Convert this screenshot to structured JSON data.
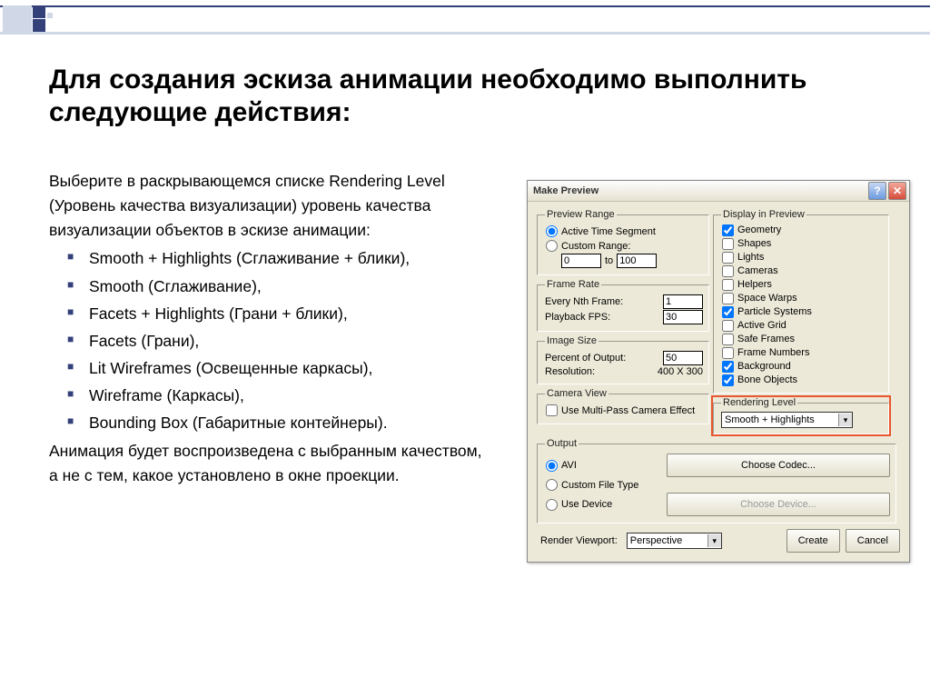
{
  "slide": {
    "title": "Для создания эскиза анимации необходимо выполнить следующие действия:",
    "intro": "Выберите в раскрывающемся списке Rendering Level (Уровень качества визуализации) уровень качества визуализации объектов в эскизе анимации:",
    "items": [
      "Smooth + Highlights (Сглаживание + блики),",
      "Smooth (Сглаживание),",
      " Facets + Highlights (Грани + блики),",
      "Facets (Грани),",
      "Lit Wireframes (Освещенные каркасы),",
      "Wireframe (Каркасы),",
      "Bounding Box (Габаритные контейнеры)."
    ],
    "outro": "Анимация будет воспроизведена с выбранным качеством, а не с тем, какое установлено в окне проекции."
  },
  "dialog": {
    "title": "Make Preview",
    "preview_range": {
      "legend": "Preview Range",
      "active_label": "Active Time Segment",
      "custom_label": "Custom Range:",
      "from": "0",
      "to_label": "to",
      "to": "100"
    },
    "frame_rate": {
      "legend": "Frame Rate",
      "nth_label": "Every Nth Frame:",
      "nth": "1",
      "fps_label": "Playback FPS:",
      "fps": "30"
    },
    "image_size": {
      "legend": "Image Size",
      "percent_label": "Percent of Output:",
      "percent": "50",
      "res_label": "Resolution:",
      "res_value": "400  X  300"
    },
    "camera": {
      "legend": "Camera View",
      "multipass_label": "Use Multi-Pass Camera Effect"
    },
    "display": {
      "legend": "Display in Preview",
      "items": [
        {
          "label": "Geometry",
          "checked": true
        },
        {
          "label": "Shapes",
          "checked": false
        },
        {
          "label": "Lights",
          "checked": false
        },
        {
          "label": "Cameras",
          "checked": false
        },
        {
          "label": "Helpers",
          "checked": false
        },
        {
          "label": "Space Warps",
          "checked": false
        },
        {
          "label": "Particle Systems",
          "checked": true
        },
        {
          "label": "Active Grid",
          "checked": false
        },
        {
          "label": "Safe Frames",
          "checked": false
        },
        {
          "label": "Frame Numbers",
          "checked": false
        },
        {
          "label": "Background",
          "checked": true
        },
        {
          "label": "Bone Objects",
          "checked": true
        }
      ]
    },
    "rendering_level": {
      "legend": "Rendering Level",
      "value": "Smooth + Highlights"
    },
    "output": {
      "legend": "Output",
      "avi_label": "AVI",
      "codec_button": "Choose Codec...",
      "custom_label": "Custom File Type",
      "device_label": "Use Device",
      "device_button": "Choose Device..."
    },
    "footer": {
      "viewport_label": "Render Viewport:",
      "viewport_value": "Perspective",
      "create": "Create",
      "cancel": "Cancel"
    }
  }
}
